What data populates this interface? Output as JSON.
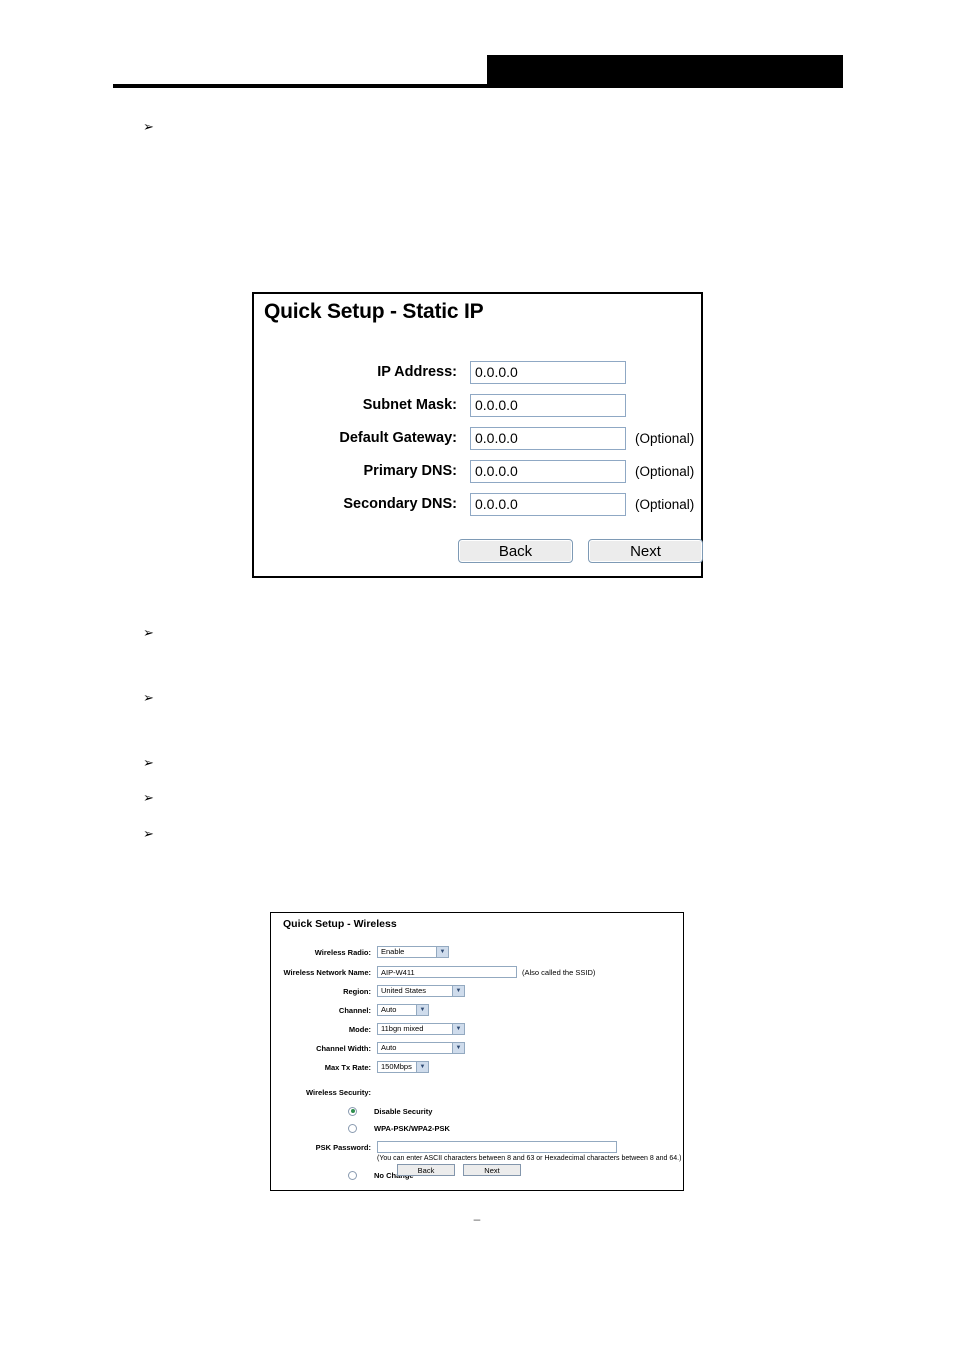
{
  "header": {
    "redacted_title": "",
    "rule": "horizontal-rule"
  },
  "bullets": [
    {
      "marker": "➢",
      "text": ""
    },
    {
      "marker": "➢",
      "text": ""
    },
    {
      "marker": "➢",
      "text": ""
    },
    {
      "marker": "➢",
      "text": ""
    },
    {
      "marker": "➢",
      "text": ""
    },
    {
      "marker": "➢",
      "text": ""
    }
  ],
  "static_ip_dialog": {
    "title": "Quick Setup - Static IP",
    "fields": [
      {
        "label": "IP Address:",
        "value": "0.0.0.0",
        "note": ""
      },
      {
        "label": "Subnet Mask:",
        "value": "0.0.0.0",
        "note": ""
      },
      {
        "label": "Default Gateway:",
        "value": "0.0.0.0",
        "note": "(Optional)"
      },
      {
        "label": "Primary DNS:",
        "value": "0.0.0.0",
        "note": "(Optional)"
      },
      {
        "label": "Secondary DNS:",
        "value": "0.0.0.0",
        "note": "(Optional)"
      }
    ],
    "back_label": "Back",
    "next_label": "Next"
  },
  "wireless_dialog": {
    "title": "Quick Setup - Wireless",
    "fields": [
      {
        "label": "Wireless Radio:",
        "value": "Enable",
        "control": "select",
        "note": ""
      },
      {
        "label": "Wireless Network Name:",
        "value": "AIP-W411",
        "control": "text",
        "note": "(Also called the SSID)"
      },
      {
        "label": "Region:",
        "value": "United States",
        "control": "select",
        "note": ""
      },
      {
        "label": "Channel:",
        "value": "Auto",
        "control": "select",
        "note": ""
      },
      {
        "label": "Mode:",
        "value": "11bgn mixed",
        "control": "select",
        "note": ""
      },
      {
        "label": "Channel Width:",
        "value": "Auto",
        "control": "select",
        "note": ""
      },
      {
        "label": "Max Tx Rate:",
        "value": "150Mbps",
        "control": "select",
        "note": ""
      }
    ],
    "security_section_label": "Wireless Security:",
    "security_options": [
      {
        "label": "Disable Security",
        "selected": true
      },
      {
        "label": "WPA-PSK/WPA2-PSK",
        "selected": false
      },
      {
        "label": "No Change",
        "selected": false
      }
    ],
    "psk_label": "PSK Password:",
    "psk_value": "",
    "psk_hint": "(You can enter ASCII characters between 8 and 63 or Hexadecimal characters between 8 and 64.)",
    "back_label": "Back",
    "next_label": "Next",
    "select_arrow_glyph": "▼"
  },
  "footer": {
    "page_marker": "–"
  },
  "colors": {
    "input_border": "#8fa8c4",
    "select_arrow_bg": "#cfdcec",
    "button_face": "#ececec",
    "radio_fill": "#2f8f4e",
    "redaction": "#000000"
  }
}
